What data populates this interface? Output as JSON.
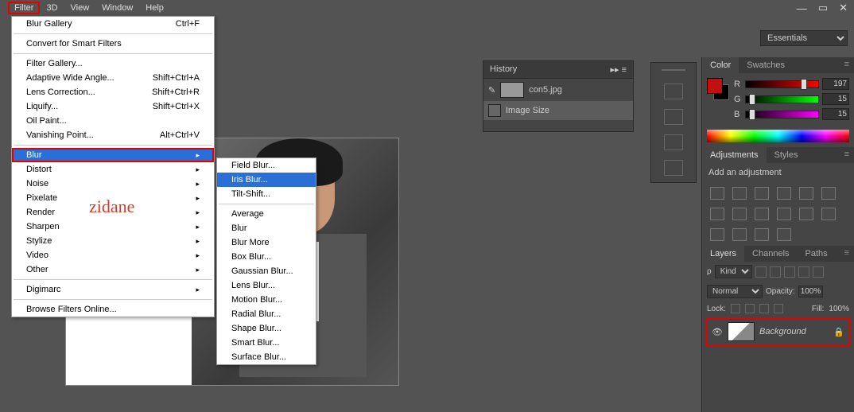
{
  "menubar": [
    "Filter",
    "3D",
    "View",
    "Window",
    "Help"
  ],
  "workspace": {
    "selected": "Essentials"
  },
  "filter_menu": {
    "items": [
      {
        "label": "Blur Gallery",
        "shortcut": "Ctrl+F",
        "type": "item"
      },
      {
        "type": "sep"
      },
      {
        "label": "Convert for Smart Filters",
        "type": "item"
      },
      {
        "type": "sep"
      },
      {
        "label": "Filter Gallery...",
        "type": "item"
      },
      {
        "label": "Adaptive Wide Angle...",
        "shortcut": "Shift+Ctrl+A",
        "type": "item"
      },
      {
        "label": "Lens Correction...",
        "shortcut": "Shift+Ctrl+R",
        "type": "item"
      },
      {
        "label": "Liquify...",
        "shortcut": "Shift+Ctrl+X",
        "type": "item"
      },
      {
        "label": "Oil Paint...",
        "type": "item"
      },
      {
        "label": "Vanishing Point...",
        "shortcut": "Alt+Ctrl+V",
        "type": "item"
      },
      {
        "type": "sep"
      },
      {
        "label": "Blur",
        "type": "sub",
        "highlighted": true,
        "selected": true
      },
      {
        "label": "Distort",
        "type": "sub"
      },
      {
        "label": "Noise",
        "type": "sub"
      },
      {
        "label": "Pixelate",
        "type": "sub"
      },
      {
        "label": "Render",
        "type": "sub"
      },
      {
        "label": "Sharpen",
        "type": "sub"
      },
      {
        "label": "Stylize",
        "type": "sub"
      },
      {
        "label": "Video",
        "type": "sub"
      },
      {
        "label": "Other",
        "type": "sub"
      },
      {
        "type": "sep"
      },
      {
        "label": "Digimarc",
        "type": "sub"
      },
      {
        "type": "sep"
      },
      {
        "label": "Browse Filters Online...",
        "type": "item"
      }
    ]
  },
  "blur_submenu": {
    "items": [
      {
        "label": "Field Blur..."
      },
      {
        "label": "Iris Blur...",
        "selected": true
      },
      {
        "label": "Tilt-Shift..."
      },
      {
        "type": "sep"
      },
      {
        "label": "Average"
      },
      {
        "label": "Blur"
      },
      {
        "label": "Blur More"
      },
      {
        "label": "Box Blur..."
      },
      {
        "label": "Gaussian Blur..."
      },
      {
        "label": "Lens Blur..."
      },
      {
        "label": "Motion Blur..."
      },
      {
        "label": "Radial Blur..."
      },
      {
        "label": "Shape Blur..."
      },
      {
        "label": "Smart Blur..."
      },
      {
        "label": "Surface Blur..."
      }
    ]
  },
  "annotation": {
    "zidane": "zidane",
    "watermark": "zidane"
  },
  "history": {
    "title": "History",
    "file": "con5.jpg",
    "steps": [
      {
        "label": "Image Size",
        "selected": true
      }
    ]
  },
  "color": {
    "tab1": "Color",
    "tab2": "Swatches",
    "foreground": "#c50f0f",
    "channels": {
      "R": 197,
      "G": 15,
      "B": 15
    }
  },
  "adjustments": {
    "tab1": "Adjustments",
    "tab2": "Styles",
    "label": "Add an adjustment"
  },
  "layers": {
    "tab1": "Layers",
    "tab2": "Channels",
    "tab3": "Paths",
    "kind_label": "Kind",
    "blend_mode": "Normal",
    "opacity_label": "Opacity:",
    "opacity_val": "100%",
    "lock_label": "Lock:",
    "fill_label": "Fill:",
    "fill_val": "100%",
    "items": [
      {
        "name": "Background"
      }
    ]
  }
}
